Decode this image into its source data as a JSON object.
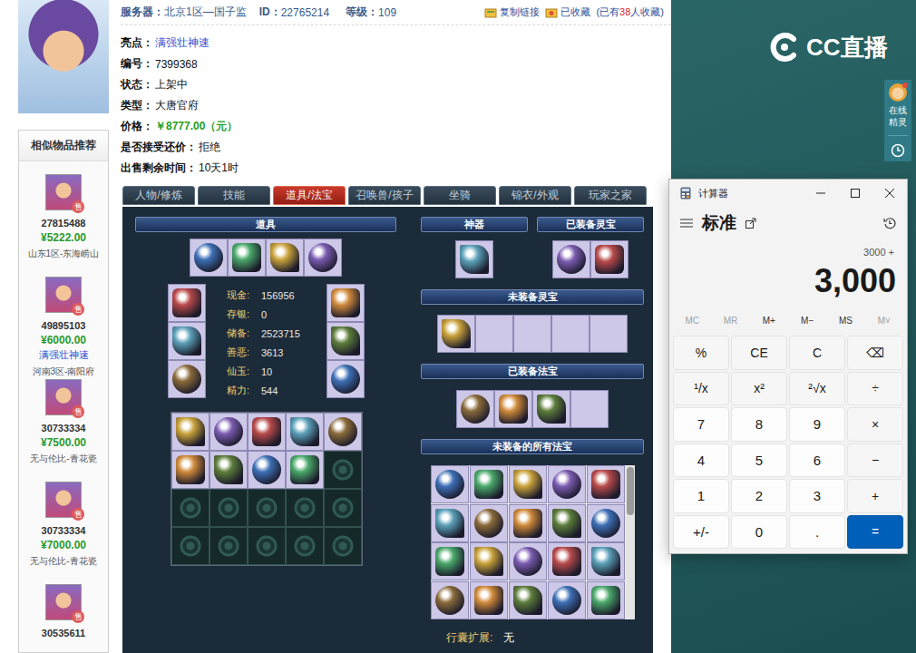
{
  "header": {
    "server_label": "服务器：",
    "server": "北京1区—国子监",
    "id_label": "ID：",
    "id": "22765214",
    "level_label": "等级：",
    "level": "109",
    "copy_link": "复制链接",
    "favorited": "已收藏",
    "fav_prefix": "(已有",
    "fav_count": "38",
    "fav_suffix": "人收藏)"
  },
  "info_rows": [
    {
      "label": "亮点：",
      "value": "满强壮神速",
      "kind": "link"
    },
    {
      "label": "编号：",
      "value": "7399368",
      "kind": "plain"
    },
    {
      "label": "状态：",
      "value": "上架中",
      "kind": "plain"
    },
    {
      "label": "类型：",
      "value": "大唐官府",
      "kind": "plain"
    },
    {
      "label": "价格：",
      "value": "￥8777.00（元）",
      "kind": "price"
    },
    {
      "label": "是否接受还价：",
      "value": "拒绝",
      "kind": "plain"
    },
    {
      "label": "出售剩余时间：",
      "value": "10天1时",
      "kind": "plain"
    }
  ],
  "sidebar": {
    "title": "相似物品推荐",
    "items": [
      {
        "id": "27815488",
        "price": "¥5222.00",
        "server": "山东1区-东海崂山",
        "badge": "售"
      },
      {
        "id": "49895103",
        "price": "¥6000.00",
        "highlight": "满强壮神速",
        "server": "河南3区-南阳府",
        "badge": "售"
      },
      {
        "id": "30733334",
        "price": "¥7500.00",
        "server": "无与伦比-青花瓷",
        "badge": "售"
      },
      {
        "id": "30733334",
        "price": "¥7000.00",
        "server": "无与伦比-青花瓷",
        "badge": "售"
      },
      {
        "id": "30535611",
        "badge": "售"
      }
    ]
  },
  "tabs": [
    {
      "label": "人物/修炼",
      "selected": false
    },
    {
      "label": "技能",
      "selected": false
    },
    {
      "label": "道具/法宝",
      "selected": true
    },
    {
      "label": "召唤兽/孩子",
      "selected": false
    },
    {
      "label": "坐骑",
      "selected": false
    },
    {
      "label": "锦衣/外观",
      "selected": false
    },
    {
      "label": "玩家之家",
      "selected": false
    }
  ],
  "inventory": {
    "title": "道具",
    "rings": [
      {
        "filled": true
      },
      {
        "filled": true
      },
      {
        "filled": true
      },
      {
        "filled": true
      }
    ],
    "left_equip": [
      {
        "filled": true
      },
      {
        "filled": true
      },
      {
        "filled": true
      }
    ],
    "right_equip": [
      {
        "filled": true
      },
      {
        "filled": true
      },
      {
        "filled": true
      }
    ],
    "stats": [
      {
        "label": "现金:",
        "value": "156956"
      },
      {
        "label": "存银:",
        "value": "0"
      },
      {
        "label": "储备:",
        "value": "2523715"
      },
      {
        "label": "善恶:",
        "value": "3613"
      },
      {
        "label": "仙玉:",
        "value": "10"
      },
      {
        "label": "精力:",
        "value": "544"
      }
    ],
    "bag": [
      {
        "filled": true
      },
      {
        "filled": true
      },
      {
        "filled": true
      },
      {
        "filled": true
      },
      {
        "filled": true
      },
      {
        "filled": true
      },
      {
        "filled": true
      },
      {
        "filled": true
      },
      {
        "filled": true
      },
      {
        "filled": false
      },
      {
        "filled": false
      },
      {
        "filled": false
      },
      {
        "filled": false
      },
      {
        "filled": false
      },
      {
        "filled": false
      },
      {
        "filled": false
      },
      {
        "filled": false
      },
      {
        "filled": false
      },
      {
        "filled": false
      },
      {
        "filled": false
      }
    ]
  },
  "treasures": {
    "artifact_title": "神器",
    "artifact": [
      {
        "filled": true
      }
    ],
    "equipped_lingbao_title": "已装备灵宝",
    "equipped_lingbao": [
      {
        "filled": true
      },
      {
        "filled": true
      }
    ],
    "unequipped_lingbao_title": "未装备灵宝",
    "unequipped_lingbao": [
      {
        "filled": true
      },
      {
        "filled": false
      },
      {
        "filled": false
      },
      {
        "filled": false
      },
      {
        "filled": false
      }
    ],
    "equipped_fabao_title": "已装备法宝",
    "equipped_fabao": [
      {
        "filled": true
      },
      {
        "filled": true
      },
      {
        "filled": true
      },
      {
        "filled": false
      }
    ],
    "all_fabao_title": "未装备的所有法宝",
    "all_fabao": [
      {
        "filled": true
      },
      {
        "filled": true
      },
      {
        "filled": true
      },
      {
        "filled": true
      },
      {
        "filled": true
      },
      {
        "filled": true
      },
      {
        "filled": true
      },
      {
        "filled": true
      },
      {
        "filled": true
      },
      {
        "filled": true
      },
      {
        "filled": true
      },
      {
        "filled": true
      },
      {
        "filled": true
      },
      {
        "filled": true
      },
      {
        "filled": true
      },
      {
        "filled": true
      },
      {
        "filled": true
      },
      {
        "filled": true
      },
      {
        "filled": true
      },
      {
        "filled": true
      }
    ],
    "all_fabao_scroll": {
      "level": 0.32
    },
    "extension_label": "行囊扩展:",
    "extension_value": "无"
  },
  "calculator": {
    "title": "计算器",
    "mode": "标准",
    "expression": "3000 +",
    "display": "3,000",
    "memory": [
      {
        "label": "MC",
        "disabled": true
      },
      {
        "label": "MR",
        "disabled": true
      },
      {
        "label": "M+",
        "disabled": false
      },
      {
        "label": "M−",
        "disabled": false
      },
      {
        "label": "MS",
        "disabled": false
      },
      {
        "label": "M˅",
        "disabled": true
      }
    ],
    "keys": [
      {
        "label": "%",
        "kind": "op"
      },
      {
        "label": "CE",
        "kind": "op"
      },
      {
        "label": "C",
        "kind": "op"
      },
      {
        "label": "⌫",
        "kind": "op"
      },
      {
        "label": "¹/x",
        "kind": "op"
      },
      {
        "label": "x²",
        "kind": "op"
      },
      {
        "label": "²√x",
        "kind": "op"
      },
      {
        "label": "÷",
        "kind": "op"
      },
      {
        "label": "7",
        "kind": "num"
      },
      {
        "label": "8",
        "kind": "num"
      },
      {
        "label": "9",
        "kind": "num"
      },
      {
        "label": "×",
        "kind": "op"
      },
      {
        "label": "4",
        "kind": "num"
      },
      {
        "label": "5",
        "kind": "num"
      },
      {
        "label": "6",
        "kind": "num"
      },
      {
        "label": "−",
        "kind": "op"
      },
      {
        "label": "1",
        "kind": "num"
      },
      {
        "label": "2",
        "kind": "num"
      },
      {
        "label": "3",
        "kind": "num"
      },
      {
        "label": "+",
        "kind": "op"
      },
      {
        "label": "+/-",
        "kind": "num"
      },
      {
        "label": "0",
        "kind": "num"
      },
      {
        "label": ".",
        "kind": "num"
      },
      {
        "label": "=",
        "kind": "equals"
      }
    ]
  },
  "stream": {
    "logo": "CC直播",
    "helper": "在线精灵"
  }
}
